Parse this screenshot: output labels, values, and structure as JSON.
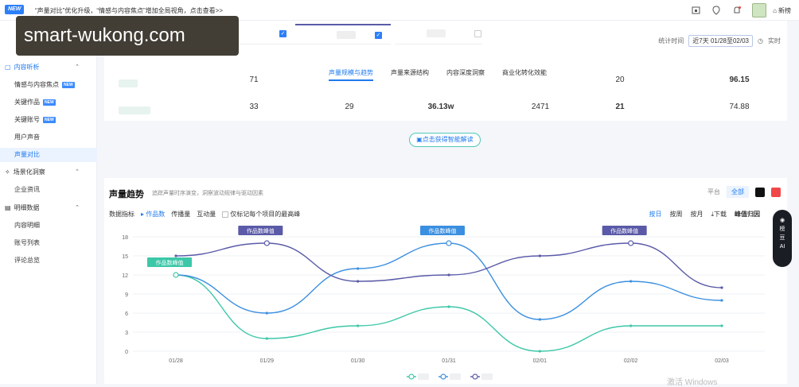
{
  "topbar": {
    "new_tag": "NEW",
    "notice": "“声量对比”优化升级，“情感与内容焦点”增加全局视角，点击查看>>",
    "home_label": "新榜"
  },
  "watermark": "smart-wukong.com",
  "sidebar": {
    "sections": [
      {
        "label": "内容听析",
        "expanded": true,
        "items": [
          {
            "label": "情感与内容焦点",
            "badge": "NEW"
          },
          {
            "label": "关键作品",
            "badge": "NEW"
          },
          {
            "label": "关键账号",
            "badge": "NEW"
          },
          {
            "label": "用户声音",
            "badge": ""
          },
          {
            "label": "声量对比",
            "badge": "",
            "selected": true
          }
        ]
      },
      {
        "label": "场景化洞察",
        "expanded": true,
        "items": [
          {
            "label": "企业资讯",
            "badge": ""
          }
        ]
      },
      {
        "label": "明细数据",
        "expanded": true,
        "items": [
          {
            "label": "内容明细",
            "badge": ""
          },
          {
            "label": "账号列表",
            "badge": ""
          },
          {
            "label": "评论总览",
            "badge": ""
          }
        ]
      }
    ]
  },
  "stat_time": {
    "label": "统计时间",
    "range": "近7天 01/28至02/03",
    "realtime": "实时"
  },
  "tabs": [
    "声量规模与趋势",
    "声量来源结构",
    "内容深度洞察",
    "商业化转化效能"
  ],
  "table_rows": [
    {
      "c1": "71",
      "c2": "",
      "c3": "",
      "c4": "",
      "c5": "20",
      "c6": "96.15"
    },
    {
      "c1": "33",
      "c2": "29",
      "c3": "36.13w",
      "c4": "2471",
      "c5": "21",
      "c6": "74.88"
    }
  ],
  "ai_button": "点击获得智能解读",
  "trend": {
    "title": "声量趋势",
    "subtitle": "追踪声量时序演变，洞察波动规律与驱动因素",
    "platform_label": "平台",
    "platform_all": "全部",
    "metric_label": "数据指标",
    "metrics": [
      "作品数",
      "传播量",
      "互动量"
    ],
    "only_peak": "仅标记每个项目的最高峰",
    "granularity": [
      "按日",
      "按周",
      "按月"
    ],
    "download": "下载",
    "peak_label": "峰值归因"
  },
  "chart_data": {
    "type": "line",
    "x": [
      "01/28",
      "01/29",
      "01/30",
      "01/31",
      "02/01",
      "02/02",
      "02/03"
    ],
    "yticks": [
      0,
      3,
      6,
      9,
      12,
      15,
      18
    ],
    "ylim": [
      0,
      18
    ],
    "series": [
      {
        "color": "#3cc7a8",
        "values": [
          12,
          2,
          4,
          7,
          0,
          4,
          4
        ]
      },
      {
        "color": "#3b8fe0",
        "values": [
          12,
          6,
          13,
          17,
          5,
          11,
          8
        ]
      },
      {
        "color": "#5a5aa8",
        "values": [
          15,
          17,
          11,
          12,
          15,
          17,
          10
        ]
      }
    ],
    "peak_annotations": [
      "作品数峰值",
      "作品数峰值",
      "作品数峰值",
      "作品数峰值"
    ]
  },
  "ai_float": {
    "l1": "榜",
    "l2": "豆",
    "l3": "AI"
  },
  "windows_mark": "激活 Windows",
  "colors": {
    "accent": "#1f7af0",
    "teal": "#3cc7a8"
  }
}
